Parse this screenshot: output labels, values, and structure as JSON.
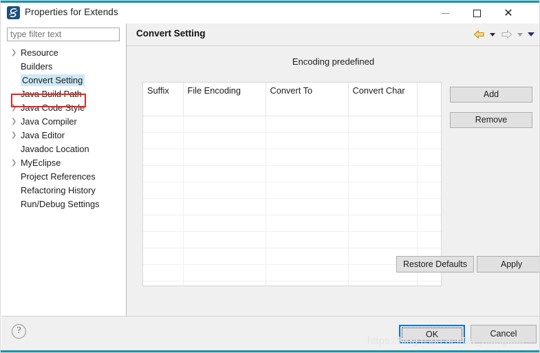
{
  "window": {
    "title": "Properties for Extends",
    "app_icon": "eclipse-icon",
    "accent_color": "#1b93ab",
    "controls": {
      "minimize": "—",
      "maximize": "□",
      "close": "✕"
    }
  },
  "sidebar": {
    "filter": {
      "value": "",
      "placeholder": "type filter text"
    },
    "items": [
      {
        "label": "Resource",
        "expandable": true,
        "selected": false
      },
      {
        "label": "Builders",
        "expandable": false,
        "selected": false
      },
      {
        "label": "Convert Setting",
        "expandable": false,
        "selected": true
      },
      {
        "label": "Java Build Path",
        "expandable": false,
        "selected": false
      },
      {
        "label": "Java Code Style",
        "expandable": true,
        "selected": false
      },
      {
        "label": "Java Compiler",
        "expandable": true,
        "selected": false
      },
      {
        "label": "Java Editor",
        "expandable": true,
        "selected": false
      },
      {
        "label": "Javadoc Location",
        "expandable": false,
        "selected": false
      },
      {
        "label": "MyEclipse",
        "expandable": true,
        "selected": false
      },
      {
        "label": "Project References",
        "expandable": false,
        "selected": false
      },
      {
        "label": "Refactoring History",
        "expandable": false,
        "selected": false
      },
      {
        "label": "Run/Debug Settings",
        "expandable": false,
        "selected": false
      }
    ],
    "annotation": {
      "color": "#ef2020",
      "target": "Convert Setting"
    }
  },
  "page": {
    "title": "Convert Setting",
    "section_title": "Encoding predefined",
    "nav": {
      "back_icon": "back-arrow-icon",
      "back_dropdown_icon": "chevron-down-icon",
      "forward_icon": "forward-arrow-icon",
      "forward_dropdown_icon": "chevron-down-icon",
      "menu_dropdown_icon": "chevron-down-icon"
    },
    "table": {
      "columns": [
        "Suffix",
        "File Encoding",
        "Convert To",
        "Convert Char",
        ""
      ],
      "rows": [],
      "empty_row_count": 12
    },
    "side_buttons": {
      "add": "Add",
      "remove": "Remove"
    },
    "page_buttons": {
      "restore_defaults": "Restore Defaults",
      "apply": "Apply"
    }
  },
  "footer": {
    "help_icon": "question-mark-icon",
    "ok": "OK",
    "cancel": "Cancel"
  },
  "watermark": {
    "text": "https://blog.csdn.net/Da_Xiong000"
  }
}
